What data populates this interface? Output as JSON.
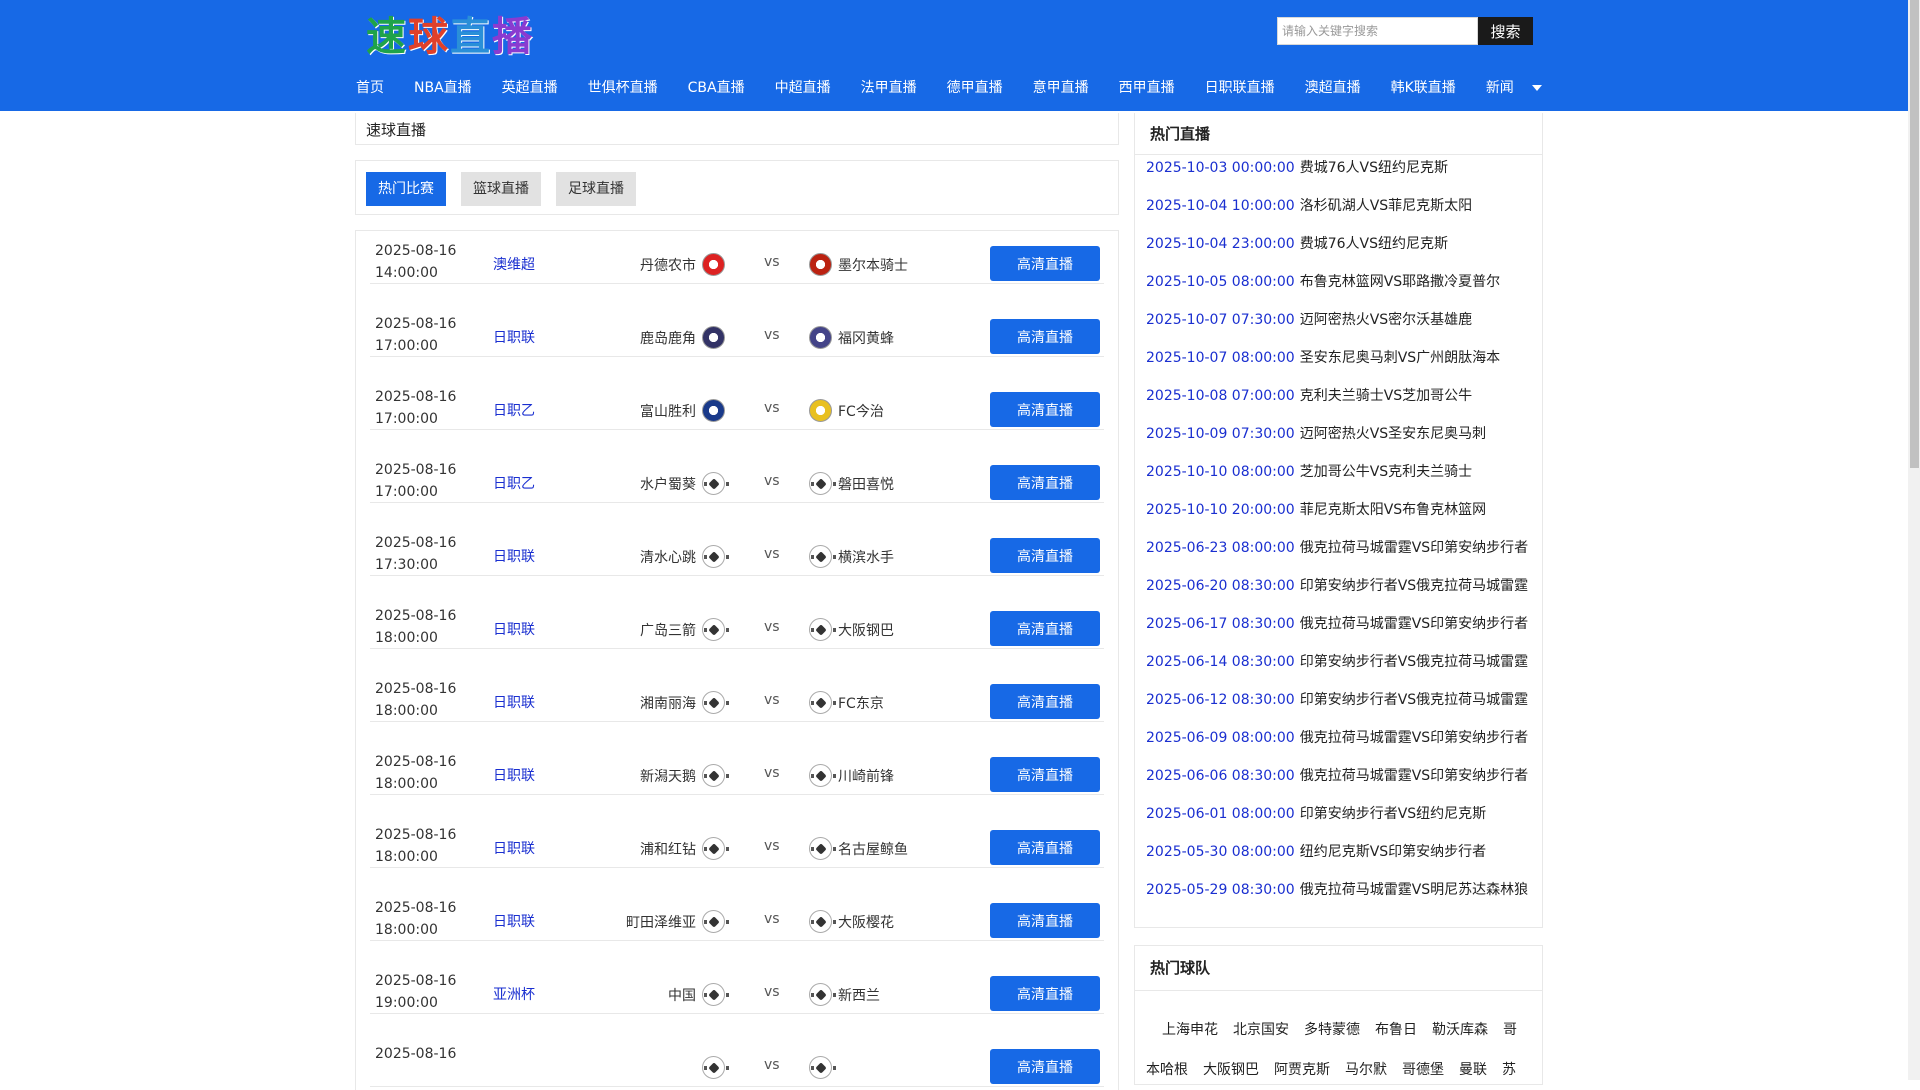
{
  "logo": {
    "text": "速球直播",
    "colors": [
      "#1fa34a",
      "#e0402a",
      "#2a8fd8",
      "#8a3bd0"
    ]
  },
  "search": {
    "placeholder": "请输入关键字搜索",
    "button_label": "搜索"
  },
  "nav": {
    "items": [
      "首页",
      "NBA直播",
      "英超直播",
      "世俱杯直播",
      "CBA直播",
      "中超直播",
      "法甲直播",
      "德甲直播",
      "意甲直播",
      "西甲直播",
      "日职联直播",
      "澳超直播",
      "韩K联直播"
    ],
    "more_label": "新闻"
  },
  "breadcrumb": "速球直播",
  "tabs": [
    "热门比赛",
    "篮球直播",
    "足球直播"
  ],
  "watch_label": "高清直播",
  "vs_label": "vs",
  "matches": [
    {
      "date": "2025-08-16",
      "time": "14:00:00",
      "league": "澳维超",
      "home": "丹德农市",
      "away": "墨尔本骑士",
      "home_icon": "crest",
      "away_icon": "crest"
    },
    {
      "date": "2025-08-16",
      "time": "17:00:00",
      "league": "日职联",
      "home": "鹿岛鹿角",
      "away": "福冈黄蜂",
      "home_icon": "crest",
      "away_icon": "crest"
    },
    {
      "date": "2025-08-16",
      "time": "17:00:00",
      "league": "日职乙",
      "home": "富山胜利",
      "away": "FC今治",
      "home_icon": "crest",
      "away_icon": "crest"
    },
    {
      "date": "2025-08-16",
      "time": "17:00:00",
      "league": "日职乙",
      "home": "水户蜀葵",
      "away": "磐田喜悦",
      "home_icon": "ball",
      "away_icon": "ball"
    },
    {
      "date": "2025-08-16",
      "time": "17:30:00",
      "league": "日职联",
      "home": "清水心跳",
      "away": "横滨水手",
      "home_icon": "ball",
      "away_icon": "ball"
    },
    {
      "date": "2025-08-16",
      "time": "18:00:00",
      "league": "日职联",
      "home": "广岛三箭",
      "away": "大阪钢巴",
      "home_icon": "ball",
      "away_icon": "ball"
    },
    {
      "date": "2025-08-16",
      "time": "18:00:00",
      "league": "日职联",
      "home": "湘南丽海",
      "away": "FC东京",
      "home_icon": "ball",
      "away_icon": "ball"
    },
    {
      "date": "2025-08-16",
      "time": "18:00:00",
      "league": "日职联",
      "home": "新潟天鹅",
      "away": "川崎前锋",
      "home_icon": "ball",
      "away_icon": "ball"
    },
    {
      "date": "2025-08-16",
      "time": "18:00:00",
      "league": "日职联",
      "home": "浦和红钻",
      "away": "名古屋鲸鱼",
      "home_icon": "ball",
      "away_icon": "ball"
    },
    {
      "date": "2025-08-16",
      "time": "18:00:00",
      "league": "日职联",
      "home": "町田泽维亚",
      "away": "大阪樱花",
      "home_icon": "ball",
      "away_icon": "ball"
    },
    {
      "date": "2025-08-16",
      "time": "19:00:00",
      "league": "亚洲杯",
      "home": "中国",
      "away": "新西兰",
      "home_icon": "ball",
      "away_icon": "ball"
    },
    {
      "date": "2025-08-16",
      "time": "",
      "league": "",
      "home": "",
      "away": "",
      "home_icon": "ball",
      "away_icon": "ball"
    }
  ],
  "hot_live": {
    "title": "热门直播",
    "items": [
      {
        "datetime": "2025-10-03 00:00:00",
        "title": "费城76人VS纽约尼克斯"
      },
      {
        "datetime": "2025-10-04 10:00:00",
        "title": "洛杉矶湖人VS菲尼克斯太阳"
      },
      {
        "datetime": "2025-10-04 23:00:00",
        "title": "费城76人VS纽约尼克斯"
      },
      {
        "datetime": "2025-10-05 08:00:00",
        "title": "布鲁克林篮网VS耶路撒冷夏普尔"
      },
      {
        "datetime": "2025-10-07 07:30:00",
        "title": "迈阿密热火VS密尔沃基雄鹿"
      },
      {
        "datetime": "2025-10-07 08:00:00",
        "title": "圣安东尼奥马刺VS广州朗肽海本"
      },
      {
        "datetime": "2025-10-08 07:00:00",
        "title": "克利夫兰骑士VS芝加哥公牛"
      },
      {
        "datetime": "2025-10-09 07:30:00",
        "title": "迈阿密热火VS圣安东尼奥马刺"
      },
      {
        "datetime": "2025-10-10 08:00:00",
        "title": "芝加哥公牛VS克利夫兰骑士"
      },
      {
        "datetime": "2025-10-10 20:00:00",
        "title": "菲尼克斯太阳VS布鲁克林篮网"
      },
      {
        "datetime": "2025-06-23 08:00:00",
        "title": "俄克拉荷马城雷霆VS印第安纳步行者"
      },
      {
        "datetime": "2025-06-20 08:30:00",
        "title": "印第安纳步行者VS俄克拉荷马城雷霆"
      },
      {
        "datetime": "2025-06-17 08:30:00",
        "title": "俄克拉荷马城雷霆VS印第安纳步行者"
      },
      {
        "datetime": "2025-06-14 08:30:00",
        "title": "印第安纳步行者VS俄克拉荷马城雷霆"
      },
      {
        "datetime": "2025-06-12 08:30:00",
        "title": "印第安纳步行者VS俄克拉荷马城雷霆"
      },
      {
        "datetime": "2025-06-09 08:00:00",
        "title": "俄克拉荷马城雷霆VS印第安纳步行者"
      },
      {
        "datetime": "2025-06-06 08:30:00",
        "title": "俄克拉荷马城雷霆VS印第安纳步行者"
      },
      {
        "datetime": "2025-06-01 08:00:00",
        "title": "印第安纳步行者VS纽约尼克斯"
      },
      {
        "datetime": "2025-05-30 08:00:00",
        "title": "纽约尼克斯VS印第安纳步行者"
      },
      {
        "datetime": "2025-05-29 08:30:00",
        "title": "俄克拉荷马城雷霆VS明尼苏达森林狼"
      }
    ]
  },
  "hot_teams": {
    "title": "热门球队",
    "rows": [
      [
        "上海申花",
        "北京国安",
        "多特蒙德",
        "布鲁日",
        "勒沃库森",
        "哥"
      ],
      [
        "本哈根",
        "大阪钢巴",
        "阿贾克斯",
        "马尔默",
        "哥德堡",
        "曼联",
        "苏"
      ]
    ]
  }
}
